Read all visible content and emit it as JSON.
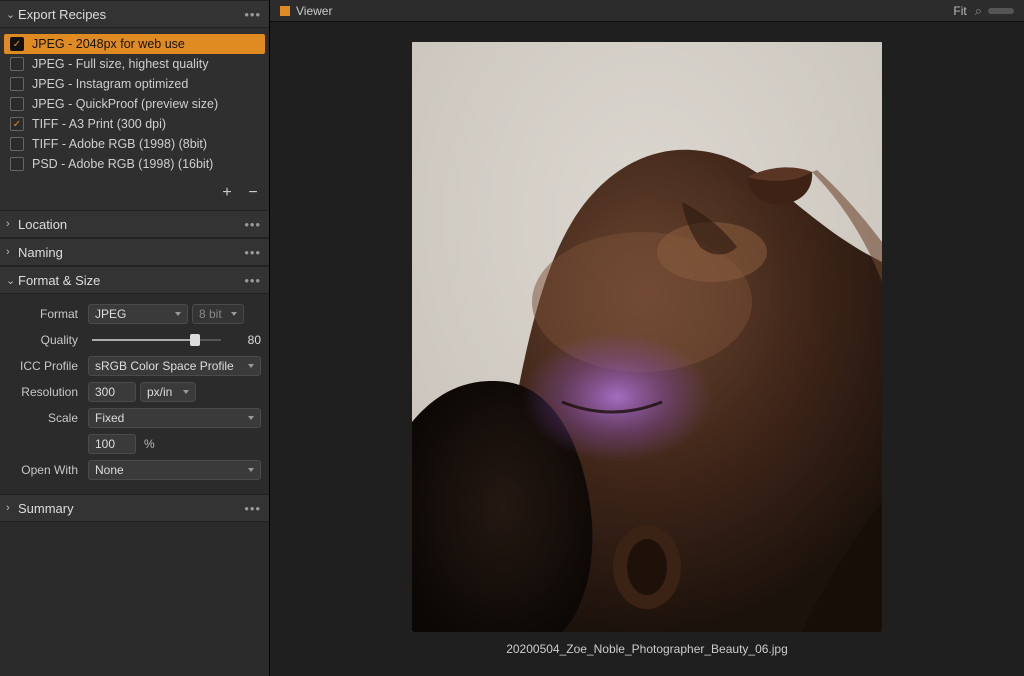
{
  "sidebar": {
    "export_recipes": {
      "title": "Export Recipes",
      "items": [
        {
          "label": "JPEG - 2048px for web use",
          "checked": true,
          "selected": true
        },
        {
          "label": "JPEG - Full size, highest quality",
          "checked": false,
          "selected": false
        },
        {
          "label": "JPEG - Instagram optimized",
          "checked": false,
          "selected": false
        },
        {
          "label": "JPEG - QuickProof (preview size)",
          "checked": false,
          "selected": false
        },
        {
          "label": "TIFF - A3 Print (300 dpi)",
          "checked": true,
          "selected": false
        },
        {
          "label": "TIFF - Adobe RGB (1998)  (8bit)",
          "checked": false,
          "selected": false
        },
        {
          "label": "PSD - Adobe RGB (1998)  (16bit)",
          "checked": false,
          "selected": false
        }
      ]
    },
    "sections": {
      "location": "Location",
      "naming": "Naming",
      "format_size": "Format & Size",
      "summary": "Summary"
    },
    "format": {
      "format_label": "Format",
      "format_value": "JPEG",
      "bitdepth_value": "8 bit",
      "quality_label": "Quality",
      "quality_value": "80",
      "quality_pct": 80,
      "icc_label": "ICC Profile",
      "icc_value": "sRGB Color Space Profile",
      "resolution_label": "Resolution",
      "resolution_value": "300",
      "resolution_unit": "px/in",
      "scale_label": "Scale",
      "scale_value": "Fixed",
      "scale_amount": "100",
      "scale_unit": "%",
      "openwith_label": "Open With",
      "openwith_value": "None"
    }
  },
  "viewer": {
    "title": "Viewer",
    "fit_label": "Fit",
    "filename": "20200504_Zoe_Noble_Photographer_Beauty_06.jpg"
  },
  "colors": {
    "accent": "#e08b21"
  }
}
